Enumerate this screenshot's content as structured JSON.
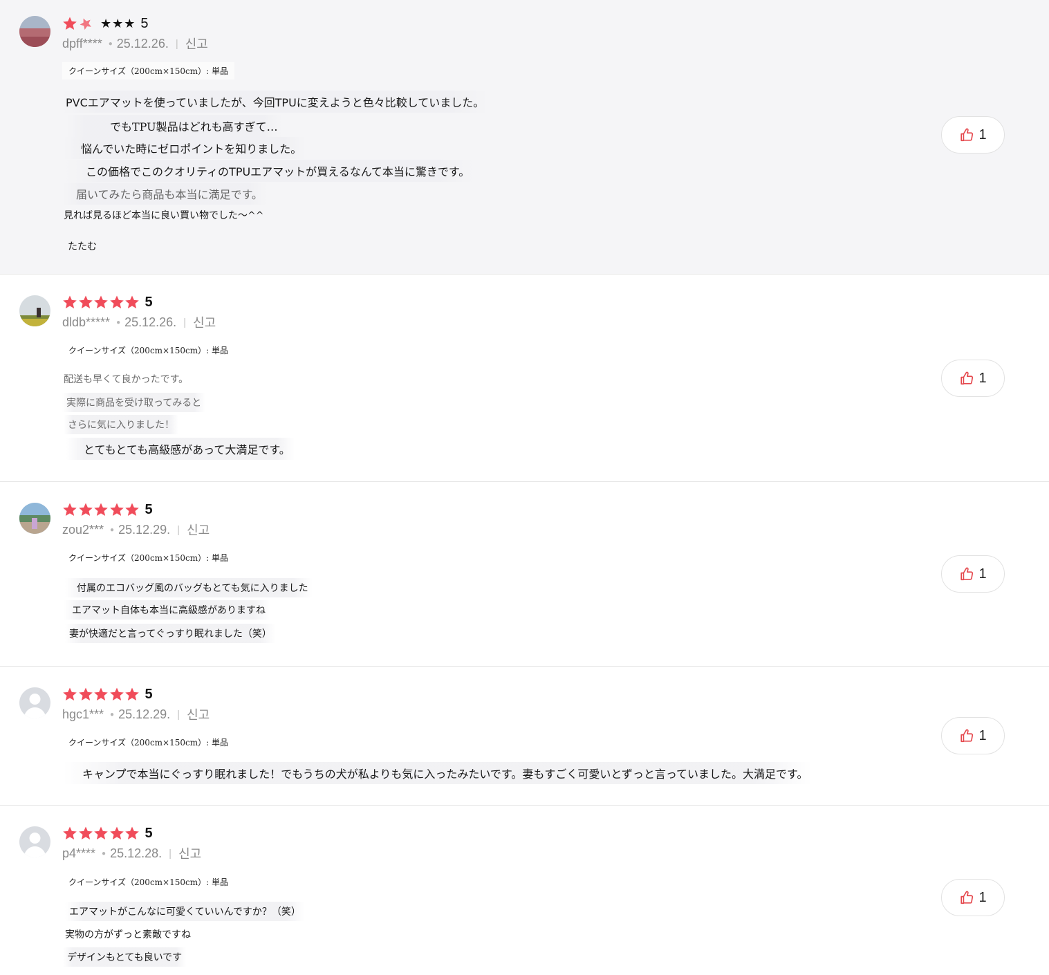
{
  "accent_star_color": "#f04c5a",
  "like_icon_color": "#e5484d",
  "reviews": [
    {
      "rating": "5",
      "mini_stars": "★★★",
      "user": "dpff****",
      "date": "25.12.26.",
      "report": "신고",
      "option": "クイーンサイズ（200cm×150cm）: 単品",
      "lines": [
        "PVCエアマットを使っていましたが、今回TPUに変えようと色々比較していました。",
        "でもTPU製品はどれも高すぎて…",
        "悩んでいた時にゼロポイントを知りました。",
        "この価格でこのクオリティのTPUエアマットが買えるなんて本当に驚きです。",
        "届いてみたら商品も本当に満足です。",
        "見れば見るほど本当に良い買い物でした～^^"
      ],
      "collapse_label": "たたむ",
      "likes": "1"
    },
    {
      "rating": "5",
      "user": "dldb*****",
      "date": "25.12.26.",
      "report": "신고",
      "option": "クイーンサイズ（200cm×150cm）: 単品",
      "lines": [
        "配送も早くて良かったです。",
        "実際に商品を受け取ってみると",
        "さらに気に入りました！",
        "とてもとても高級感があって大満足です。"
      ],
      "likes": "1"
    },
    {
      "rating": "5",
      "user": "zou2***",
      "date": "25.12.29.",
      "report": "신고",
      "option": "クイーンサイズ（200cm×150cm）: 単品",
      "lines": [
        "付属のエコバッグ風のバッグもとても気に入りました",
        "エアマット自体も本当に高級感がありますね",
        "妻が快適だと言ってぐっすり眠れました（笑）"
      ],
      "likes": "1"
    },
    {
      "rating": "5",
      "user": "hgc1***",
      "date": "25.12.29.",
      "report": "신고",
      "option": "クイーンサイズ（200cm×150cm）: 単品",
      "lines": [
        "キャンプで本当にぐっすり眠れました！でもうちの犬が私よりも気に入ったみたいです。妻もすごく可愛いとずっと言っていました。大満足です。"
      ],
      "likes": "1"
    },
    {
      "rating": "5",
      "user": "p4****",
      "date": "25.12.28.",
      "report": "신고",
      "option": "クイーンサイズ（200cm×150cm）: 単品",
      "lines": [
        "エアマットがこんなに可愛くていいんですか？（笑）",
        "実物の方がずっと素敵ですね",
        "デザインもとても良いです"
      ],
      "likes": "1"
    }
  ]
}
